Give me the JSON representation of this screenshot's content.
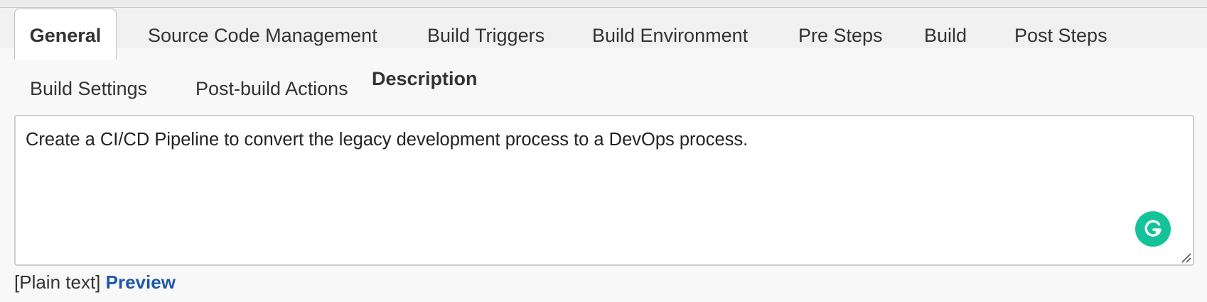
{
  "tabs": [
    {
      "label": "General",
      "active": true
    },
    {
      "label": "Source Code Management",
      "active": false
    },
    {
      "label": "Build Triggers",
      "active": false
    },
    {
      "label": "Build Environment",
      "active": false
    },
    {
      "label": "Pre Steps",
      "active": false
    },
    {
      "label": "Build",
      "active": false
    },
    {
      "label": "Post Steps",
      "active": false
    },
    {
      "label": "Build Settings",
      "active": false
    },
    {
      "label": "Post-build Actions",
      "active": false
    }
  ],
  "description": {
    "label": "Description",
    "value": "Create a CI/CD Pipeline to convert the legacy development process to a DevOps process.",
    "format_label": "[Plain text]",
    "preview_label": "Preview"
  },
  "icons": {
    "assistant": "grammarly-icon",
    "resize": "resize-grip-icon"
  },
  "colors": {
    "link": "#1f57a7",
    "grammarly": "#15c39a"
  }
}
